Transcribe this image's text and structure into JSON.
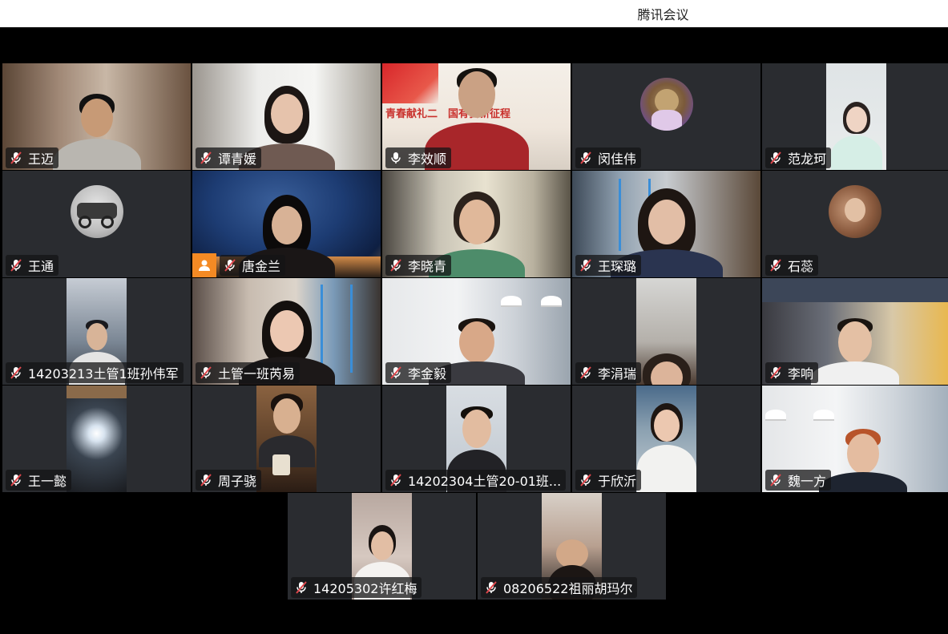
{
  "window": {
    "title": "腾讯会议"
  },
  "participants": [
    {
      "name": "王迈",
      "muted": true
    },
    {
      "name": "谭青媛",
      "muted": true
    },
    {
      "name": "李效顺",
      "muted": false,
      "banner": "青春献礼二　国有我新征程"
    },
    {
      "name": "闵佳伟",
      "muted": true
    },
    {
      "name": "范龙珂",
      "muted": true
    },
    {
      "name": "王通",
      "muted": true
    },
    {
      "name": "唐金兰",
      "muted": true
    },
    {
      "name": "李晓青",
      "muted": true
    },
    {
      "name": "王琛璐",
      "muted": true
    },
    {
      "name": "石蕊",
      "muted": true
    },
    {
      "name": "14203213土管1班孙伟军",
      "muted": true
    },
    {
      "name": "土管一班芮易",
      "muted": true
    },
    {
      "name": "李金毅",
      "muted": true
    },
    {
      "name": "李涓瑞",
      "muted": true
    },
    {
      "name": "李响",
      "muted": true
    },
    {
      "name": "王一懿",
      "muted": true
    },
    {
      "name": "周子骁",
      "muted": true
    },
    {
      "name": "14202304土管20-01班...",
      "muted": true
    },
    {
      "name": "于欣沂",
      "muted": true
    },
    {
      "name": "魏一方",
      "muted": true
    },
    {
      "name": "14205302许红梅",
      "muted": true
    },
    {
      "name": "08206522祖丽胡玛尔",
      "muted": true
    }
  ],
  "colors": {
    "tile_bg": "#2a2c30",
    "muted_slash": "#e0474c",
    "host_badge": "#f48a24"
  }
}
